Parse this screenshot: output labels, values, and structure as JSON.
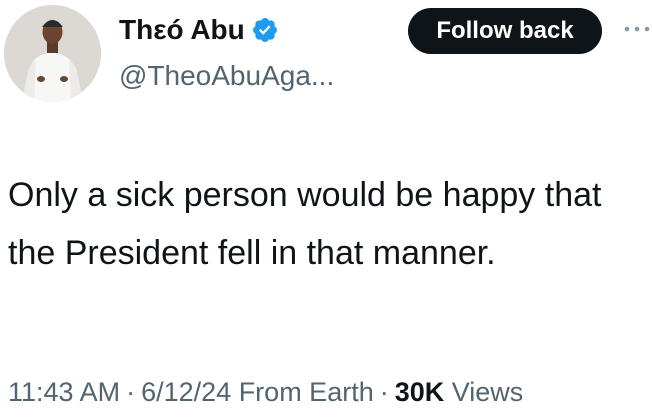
{
  "user": {
    "display_name": "Thεó Abu",
    "handle": "@TheoAbuAga...",
    "verified_icon": "verified-badge-icon",
    "avatar": "avatar"
  },
  "actions": {
    "follow_label": "Follow back",
    "more_icon": "more-icon"
  },
  "tweet": {
    "text": "Only a sick person would be happy that the President fell in that manner."
  },
  "meta": {
    "time": "11:43 AM",
    "date": "6/12/24",
    "source": "From Earth",
    "separator": "·",
    "views_count": "30K",
    "views_label": "Views"
  },
  "colors": {
    "text": "#0f1419",
    "secondary": "#536471",
    "verified": "#1d9bf0",
    "button_bg": "#0f1419"
  }
}
